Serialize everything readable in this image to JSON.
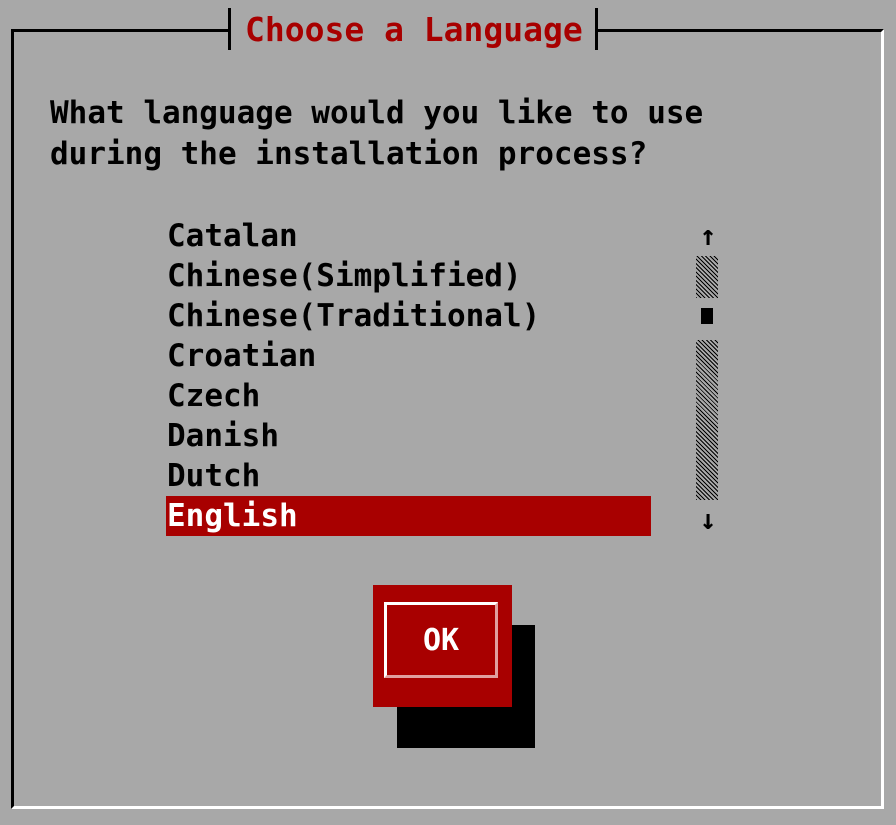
{
  "dialog": {
    "title": "Choose a Language",
    "prompt": "What language would you like to use\nduring the installation process?"
  },
  "languages": {
    "items": [
      "Catalan",
      "Chinese(Simplified)",
      "Chinese(Traditional)",
      "Croatian",
      "Czech",
      "Danish",
      "Dutch",
      "English"
    ],
    "selected": "English"
  },
  "scrollbar": {
    "up_arrow": "↑",
    "down_arrow": "↓"
  },
  "buttons": {
    "ok_label": "OK"
  },
  "colors": {
    "background": "#a8a8a8",
    "accent_red": "#a80000",
    "text": "#000000",
    "highlight_text": "#ffffff"
  }
}
